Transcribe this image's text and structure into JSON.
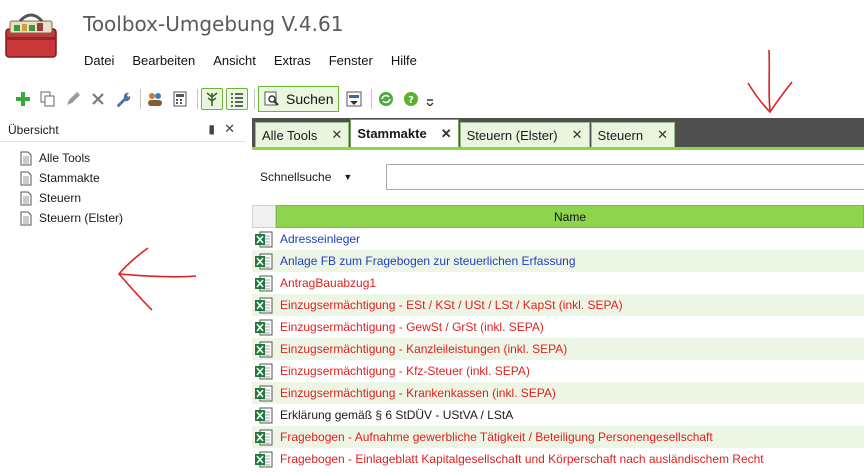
{
  "app": {
    "title": "Toolbox-Umgebung V.4.61",
    "logo_icon": "toolbox-logo-icon"
  },
  "menu": [
    "Datei",
    "Bearbeiten",
    "Ansicht",
    "Extras",
    "Fenster",
    "Hilfe"
  ],
  "toolbar": {
    "search_label": "Suchen",
    "icons": [
      "add-icon",
      "copy-icon",
      "edit-icon",
      "delete-icon",
      "wrench-icon",
      "users-icon",
      "calculator-icon",
      "tree-icon",
      "list-icon",
      "search-icon",
      "filter-icon",
      "refresh-icon",
      "help-icon",
      "overflow-icon"
    ]
  },
  "left_panel": {
    "title": "Übersicht",
    "pin_glyph": "▮",
    "close_glyph": "✕",
    "items": [
      {
        "label": "Alle Tools"
      },
      {
        "label": "Stammakte"
      },
      {
        "label": "Steuern"
      },
      {
        "label": "Steuern (Elster)"
      }
    ]
  },
  "tabs": [
    {
      "label": "Alle Tools",
      "active": false
    },
    {
      "label": "Stammakte",
      "active": true
    },
    {
      "label": "Steuern (Elster)",
      "active": false
    },
    {
      "label": "Steuern",
      "active": false
    }
  ],
  "tab_close_glyph": "✕",
  "quicksearch": {
    "label": "Schnellsuche",
    "dropdown_glyph": "▼",
    "value": ""
  },
  "grid": {
    "column_header": "Name",
    "rows": [
      {
        "text": "Adresseinleger",
        "color": "#1f3fbf"
      },
      {
        "text": "Anlage FB zum Fragebogen zur steuerlichen Erfassung",
        "color": "#1f3fbf"
      },
      {
        "text": "AntragBauabzug1",
        "color": "#e02020"
      },
      {
        "text": "Einzugsermächtigung - ESt / KSt / USt / LSt / KapSt (inkl. SEPA)",
        "color": "#e02020"
      },
      {
        "text": "Einzugsermächtigung - GewSt / GrSt (inkl. SEPA)",
        "color": "#e02020"
      },
      {
        "text": "Einzugsermächtigung - Kanzleileistungen (inkl. SEPA)",
        "color": "#e02020"
      },
      {
        "text": "Einzugsermächtigung - Kfz-Steuer (inkl. SEPA)",
        "color": "#e02020"
      },
      {
        "text": "Einzugsermächtigung - Krankenkassen  (inkl. SEPA)",
        "color": "#e02020"
      },
      {
        "text": "Erklärung gemäß § 6 StDÜV - UStVA / LStA",
        "color": "#1a1a1a"
      },
      {
        "text": "Fragebogen - Aufnahme gewerbliche Tätigkeit / Beteiligung Personengesellschaft",
        "color": "#e02020"
      },
      {
        "text": "Fragebogen - Einlageblatt Kapitalgesellschaft und Körperschaft nach ausländischem Recht",
        "color": "#e02020"
      }
    ]
  },
  "colors": {
    "accent_green": "#8ed44f",
    "annotation_red": "#e02020"
  }
}
